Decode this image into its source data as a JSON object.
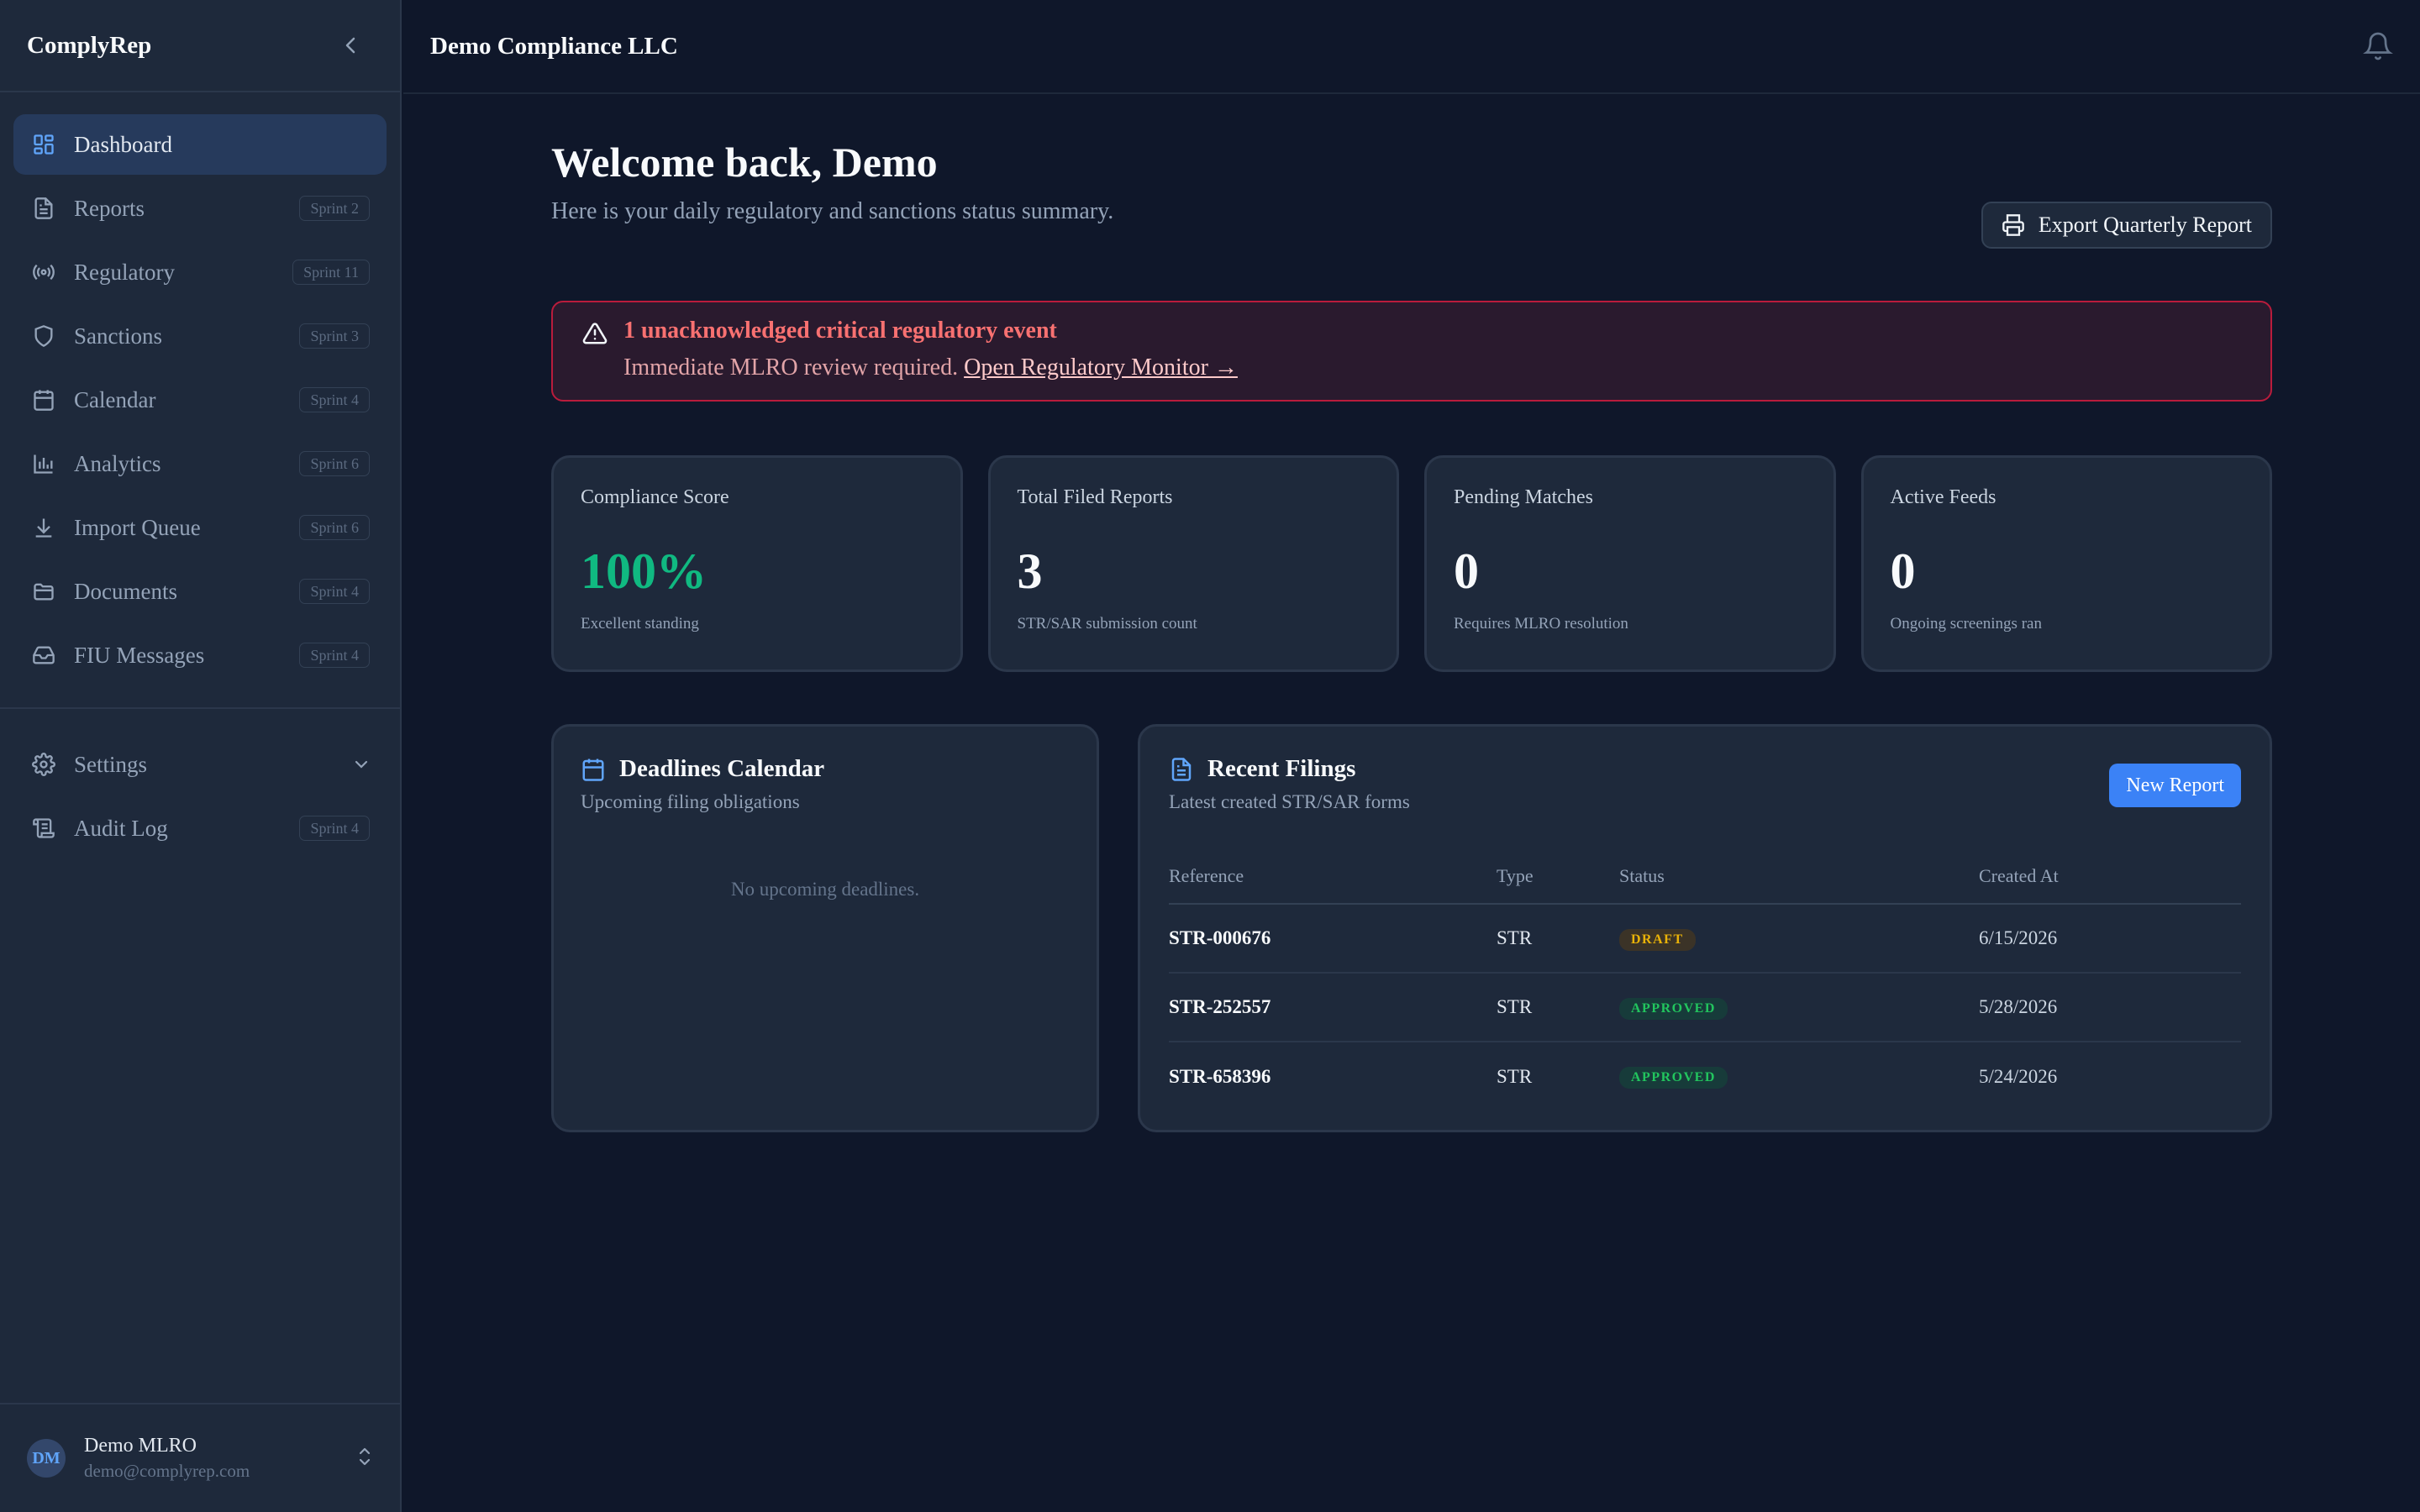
{
  "sidebar": {
    "brand": "ComplyRep",
    "items": [
      {
        "label": "Dashboard",
        "badge": "",
        "icon": "dashboard-icon",
        "active": true
      },
      {
        "label": "Reports",
        "badge": "Sprint 2",
        "icon": "file-text-icon"
      },
      {
        "label": "Regulatory",
        "badge": "Sprint 11",
        "icon": "radio-icon"
      },
      {
        "label": "Sanctions",
        "badge": "Sprint 3",
        "icon": "shield-icon"
      },
      {
        "label": "Calendar",
        "badge": "Sprint 4",
        "icon": "calendar-icon"
      },
      {
        "label": "Analytics",
        "badge": "Sprint 6",
        "icon": "bar-chart-icon"
      },
      {
        "label": "Import Queue",
        "badge": "Sprint 6",
        "icon": "download-icon"
      },
      {
        "label": "Documents",
        "badge": "Sprint 4",
        "icon": "folder-icon"
      },
      {
        "label": "FIU Messages",
        "badge": "Sprint 4",
        "icon": "inbox-icon"
      }
    ],
    "settings_label": "Settings",
    "audit_label": "Audit Log",
    "audit_badge": "Sprint 4",
    "user": {
      "initials": "DM",
      "name": "Demo MLRO",
      "email": "demo@complyrep.com"
    }
  },
  "topbar": {
    "org_name": "Demo Compliance LLC"
  },
  "welcome": {
    "title": "Welcome back, Demo",
    "subtitle": "Here is your daily regulatory and sanctions status summary.",
    "export_label": "Export Quarterly Report"
  },
  "alert": {
    "title": "1 unacknowledged critical regulatory event",
    "message": "Immediate MLRO review required.",
    "link": "Open Regulatory Monitor →"
  },
  "stats": [
    {
      "label": "Compliance Score",
      "value": "100%",
      "note": "Excellent standing"
    },
    {
      "label": "Total Filed Reports",
      "value": "3",
      "note": "STR/SAR submission count"
    },
    {
      "label": "Pending Matches",
      "value": "0",
      "note": "Requires MLRO resolution"
    },
    {
      "label": "Active Feeds",
      "value": "0",
      "note": "Ongoing screenings ran"
    }
  ],
  "deadlines": {
    "title": "Deadlines Calendar",
    "subtitle": "Upcoming filing obligations",
    "empty": "No upcoming deadlines."
  },
  "filings": {
    "title": "Recent Filings",
    "subtitle": "Latest created STR/SAR forms",
    "new_label": "New Report",
    "columns": [
      "Reference",
      "Type",
      "Status",
      "Created At"
    ],
    "rows": [
      {
        "ref": "STR-000676",
        "type": "STR",
        "status": "DRAFT",
        "created": "6/15/2026"
      },
      {
        "ref": "STR-252557",
        "type": "STR",
        "status": "APPROVED",
        "created": "5/28/2026"
      },
      {
        "ref": "STR-658396",
        "type": "STR",
        "status": "APPROVED",
        "created": "5/24/2026"
      }
    ]
  },
  "colors": {
    "accent": "#3b82f6",
    "success": "#10b981",
    "danger": "#b91c3c",
    "warning": "#eab308"
  }
}
